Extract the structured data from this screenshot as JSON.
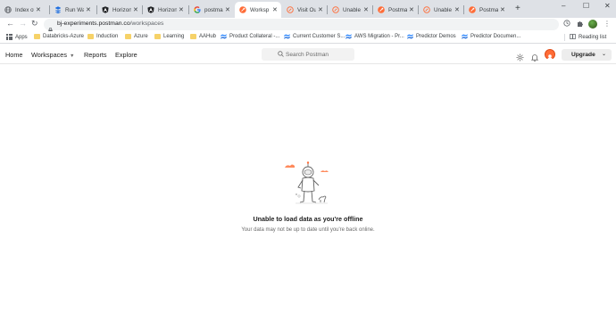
{
  "browser": {
    "tabs": [
      {
        "title": "Index of",
        "icon": "globe-icon",
        "active": false
      },
      {
        "title": "Run Wa",
        "icon": "databricks-icon",
        "active": false
      },
      {
        "title": "Horizon",
        "icon": "angular-icon",
        "active": false
      },
      {
        "title": "Horizon",
        "icon": "angular-icon",
        "active": false
      },
      {
        "title": "postma",
        "icon": "google-icon",
        "active": false
      },
      {
        "title": "Worksp",
        "icon": "postman-icon",
        "active": true
      },
      {
        "title": "Visit Ou",
        "icon": "postman-outline-icon",
        "active": false
      },
      {
        "title": "Unable t",
        "icon": "postman-outline-icon",
        "active": false
      },
      {
        "title": "Postma",
        "icon": "postman-icon",
        "active": false
      },
      {
        "title": "Unable t",
        "icon": "postman-outline-icon",
        "active": false
      },
      {
        "title": "Postma",
        "icon": "postman-icon",
        "active": false
      }
    ],
    "new_tab": "+",
    "window_controls": {
      "minimize": "–",
      "maximize": "☐",
      "close": "✕"
    },
    "url": {
      "host": "bj-experiments.postman.co",
      "path": "/workspaces"
    },
    "bookmarks": [
      {
        "label": "Apps",
        "icon": "apps-icon"
      },
      {
        "label": "Databricks-Azure",
        "icon": "folder-icon"
      },
      {
        "label": "Induction",
        "icon": "folder-icon"
      },
      {
        "label": "Azure",
        "icon": "folder-icon"
      },
      {
        "label": "Learning",
        "icon": "folder-icon"
      },
      {
        "label": "AAHub",
        "icon": "folder-icon"
      },
      {
        "label": "Product Collateral -...",
        "icon": "confluence-icon"
      },
      {
        "label": "Current Customer S...",
        "icon": "confluence-icon"
      },
      {
        "label": "AWS Migration - Pr...",
        "icon": "confluence-icon"
      },
      {
        "label": "Predictor Demos",
        "icon": "confluence-icon"
      },
      {
        "label": "Predictor Documen...",
        "icon": "confluence-icon"
      }
    ],
    "reading_list": "Reading list"
  },
  "postman": {
    "nav": {
      "home": "Home",
      "workspaces": "Workspaces",
      "reports": "Reports",
      "explore": "Explore"
    },
    "search_placeholder": "Search Postman",
    "upgrade_label": "Upgrade",
    "accent": "#ff6c37"
  },
  "empty_state": {
    "title": "Unable to load data as you're offline",
    "subtitle": "Your data may not be up to date until you're back online."
  }
}
